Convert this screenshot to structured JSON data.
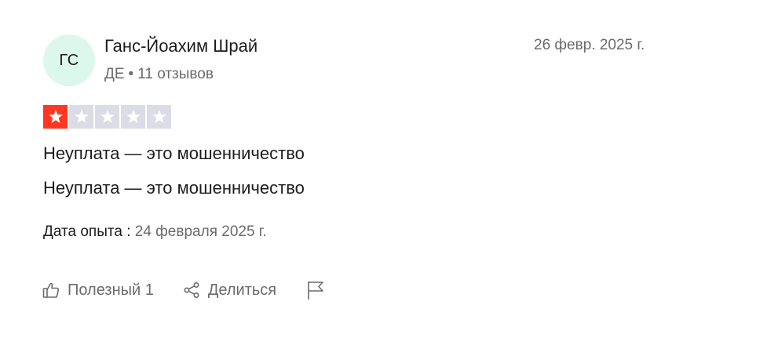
{
  "review": {
    "author": {
      "initials": "ГС",
      "name": "Ганс-Йоахим Шрай",
      "country": "ДЕ",
      "separator": "•",
      "reviews_count": "11 отзывов"
    },
    "date": "26 февр. 2025 г.",
    "rating": 1,
    "rating_max": 5,
    "title": "Неуплата — это мошенничество",
    "text": "Неуплата — это мошенничество",
    "experience": {
      "label": "Дата опыта :",
      "value": "24 февраля 2025 г."
    },
    "actions": {
      "useful_label": "Полезный 1",
      "share_label": "Делиться",
      "useful_icon": "thumbs-up-icon",
      "share_icon": "share-icon",
      "report_icon": "flag-icon"
    }
  },
  "colors": {
    "star_filled": "#ff3722",
    "star_empty": "#dcdce6",
    "avatar_bg": "#dcf7ec",
    "muted_text": "#6b6b6b"
  }
}
